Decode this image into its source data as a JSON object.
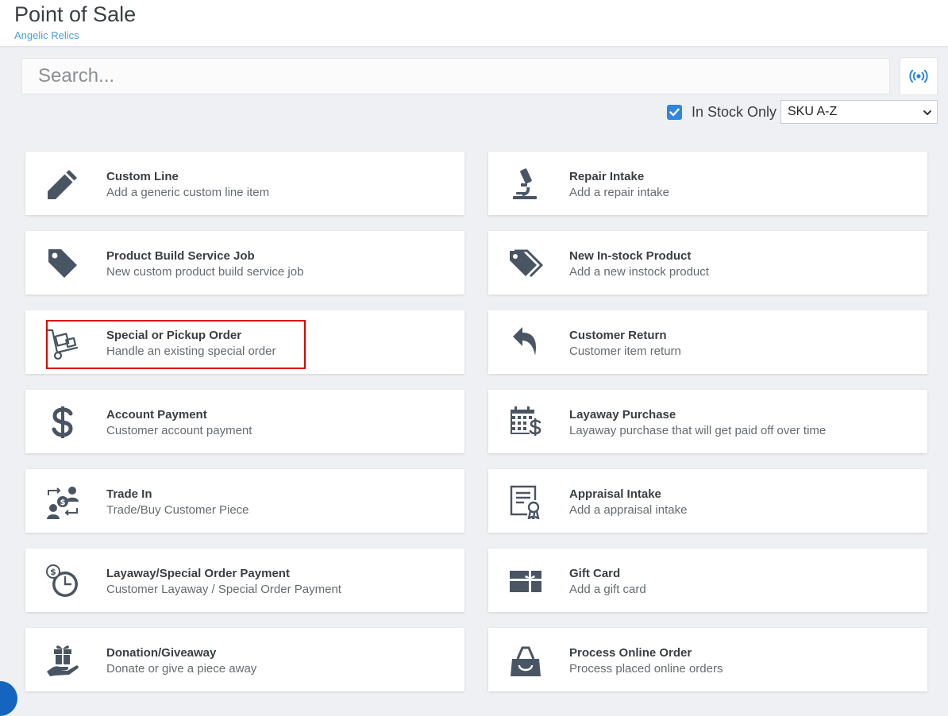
{
  "header": {
    "title": "Point of Sale",
    "store": "Angelic Relics"
  },
  "search": {
    "placeholder": "Search..."
  },
  "scan_button": {
    "icon": "broadcast-icon"
  },
  "filters": {
    "in_stock_label": "In Stock Only",
    "in_stock_checked": true,
    "sort_selected": "SKU A-Z"
  },
  "colors": {
    "accent": "#2e86de",
    "icon": "#4a5563",
    "highlight": "#e00000"
  },
  "tiles": [
    {
      "title": "Custom Line",
      "desc": "Add a generic custom line item",
      "icon": "pencil-icon"
    },
    {
      "title": "Repair Intake",
      "desc": "Add a repair intake",
      "icon": "microscope-icon"
    },
    {
      "title": "Product Build Service Job",
      "desc": "New custom product build service job",
      "icon": "tag-icon"
    },
    {
      "title": "New In-stock Product",
      "desc": "Add a new instock product",
      "icon": "tags-icon"
    },
    {
      "title": "Special or Pickup Order",
      "desc": "Handle an existing special order",
      "icon": "hand-truck-icon"
    },
    {
      "title": "Customer Return",
      "desc": "Customer item return",
      "icon": "reply-arrow-icon"
    },
    {
      "title": "Account Payment",
      "desc": "Customer account payment",
      "icon": "dollar-icon"
    },
    {
      "title": "Layaway Purchase",
      "desc": "Layaway purchase that will get paid off over time",
      "icon": "calendar-dollar-icon"
    },
    {
      "title": "Trade In",
      "desc": "Trade/Buy Customer Piece",
      "icon": "trade-exchange-icon"
    },
    {
      "title": "Appraisal Intake",
      "desc": "Add a appraisal intake",
      "icon": "certificate-icon"
    },
    {
      "title": "Layaway/Special Order Payment",
      "desc": "Customer Layaway / Special Order Payment",
      "icon": "clock-dollar-icon"
    },
    {
      "title": "Gift Card",
      "desc": "Add a gift card",
      "icon": "gift-card-icon"
    },
    {
      "title": "Donation/Giveaway",
      "desc": "Donate or give a piece away",
      "icon": "hand-gift-icon"
    },
    {
      "title": "Process Online Order",
      "desc": "Process placed online orders",
      "icon": "shopping-bag-icon"
    }
  ]
}
